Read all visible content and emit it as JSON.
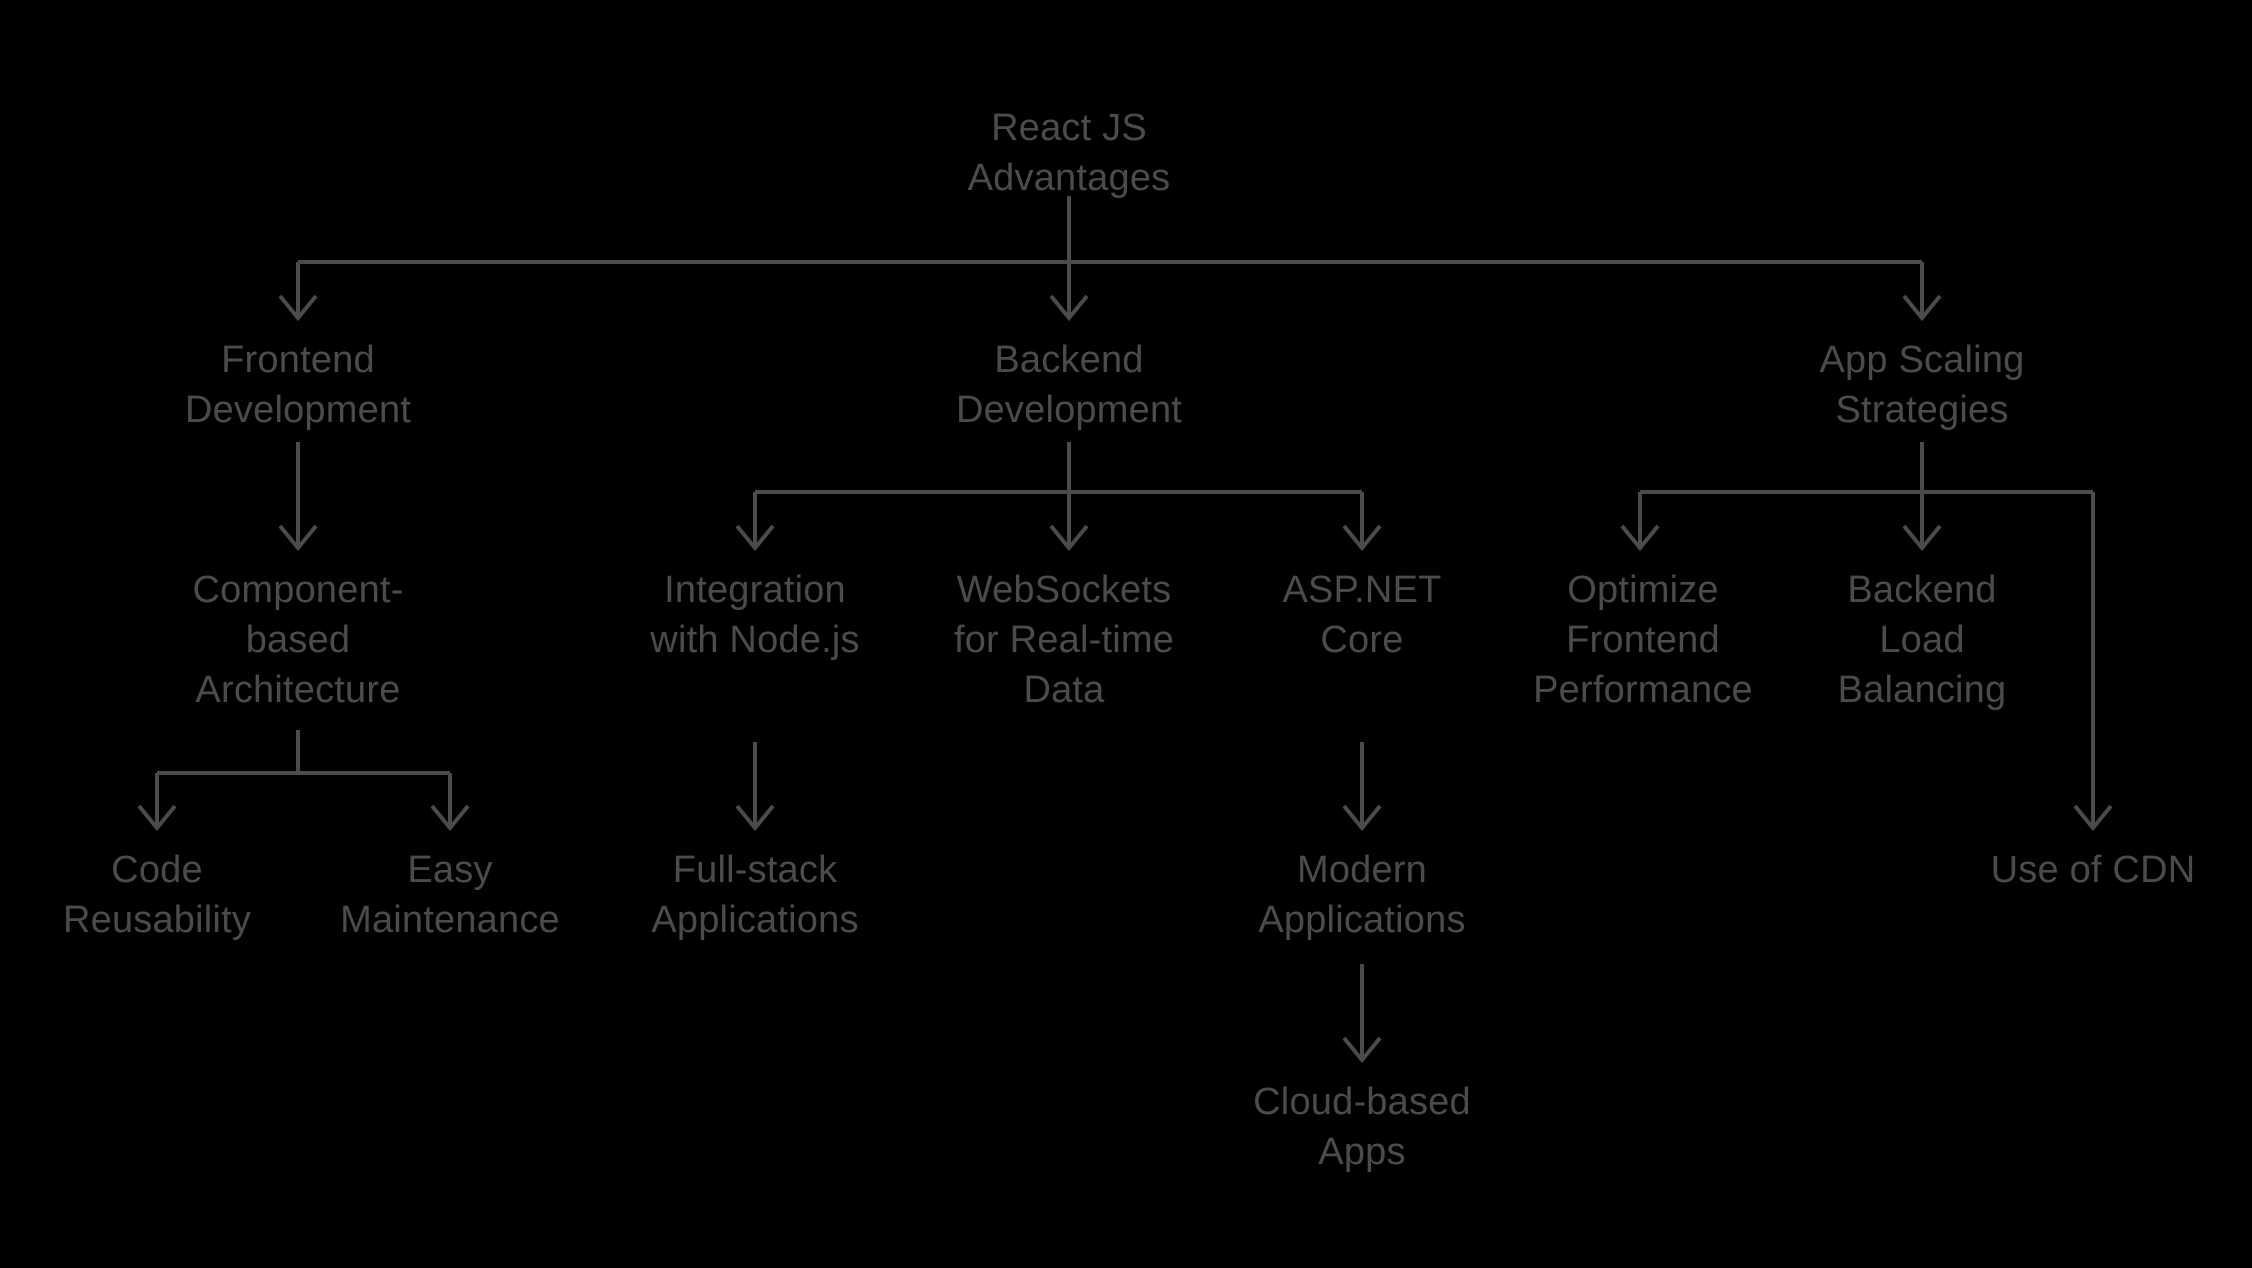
{
  "diagram": {
    "title": "React JS Advantages",
    "type": "tree-flowchart",
    "background_color": "#000000",
    "text_color": "#4b4b4b",
    "edge_color": "#4b4b4b",
    "nodes": {
      "root": {
        "line1": "React JS",
        "line2": "Advantages"
      },
      "frontend": {
        "line1": "Frontend",
        "line2": "Development"
      },
      "backend": {
        "line1": "Backend",
        "line2": "Development"
      },
      "scaling": {
        "line1": "App Scaling",
        "line2": "Strategies"
      },
      "component": {
        "line1": "Component-",
        "line2": "based",
        "line3": "Architecture"
      },
      "integration": {
        "line1": "Integration",
        "line2": "with Node.js"
      },
      "websockets": {
        "line1": "WebSockets",
        "line2": "for Real-time",
        "line3": "Data"
      },
      "aspnet": {
        "line1": "ASP.NET",
        "line2": "Core"
      },
      "optimize": {
        "line1": "Optimize",
        "line2": "Frontend",
        "line3": "Performance"
      },
      "loadbalancing": {
        "line1": "Backend",
        "line2": "Load",
        "line3": "Balancing"
      },
      "codereuse": {
        "line1": "Code",
        "line2": "Reusability"
      },
      "easymaint": {
        "line1": "Easy",
        "line2": "Maintenance"
      },
      "fullstack": {
        "line1": "Full-stack",
        "line2": "Applications"
      },
      "modernapps": {
        "line1": "Modern",
        "line2": "Applications"
      },
      "cdn": {
        "line1": "Use of CDN"
      },
      "cloudapps": {
        "line1": "Cloud-based",
        "line2": "Apps"
      }
    }
  }
}
